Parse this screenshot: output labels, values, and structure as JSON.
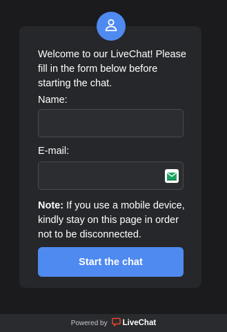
{
  "colors": {
    "accent": "#4f8af0",
    "background": "#1b1b1d",
    "card": "#26272a",
    "livechat_red": "#e8452c"
  },
  "icons": {
    "avatar": "user-icon",
    "email_field": "email-green-icon",
    "footer_logo": "livechat-logo-icon"
  },
  "form": {
    "welcome": "Welcome to our LiveChat! Please fill in the form below before starting the chat.",
    "name_label": "Name:",
    "name_value": "",
    "email_label": "E-mail:",
    "email_value": "",
    "note_strong": "Note:",
    "note_text": " If you use a mobile device, kindly stay on this page in order not to be disconnected.",
    "submit_label": "Start the chat"
  },
  "footer": {
    "powered_by": "Powered by",
    "brand": "LiveChat"
  }
}
